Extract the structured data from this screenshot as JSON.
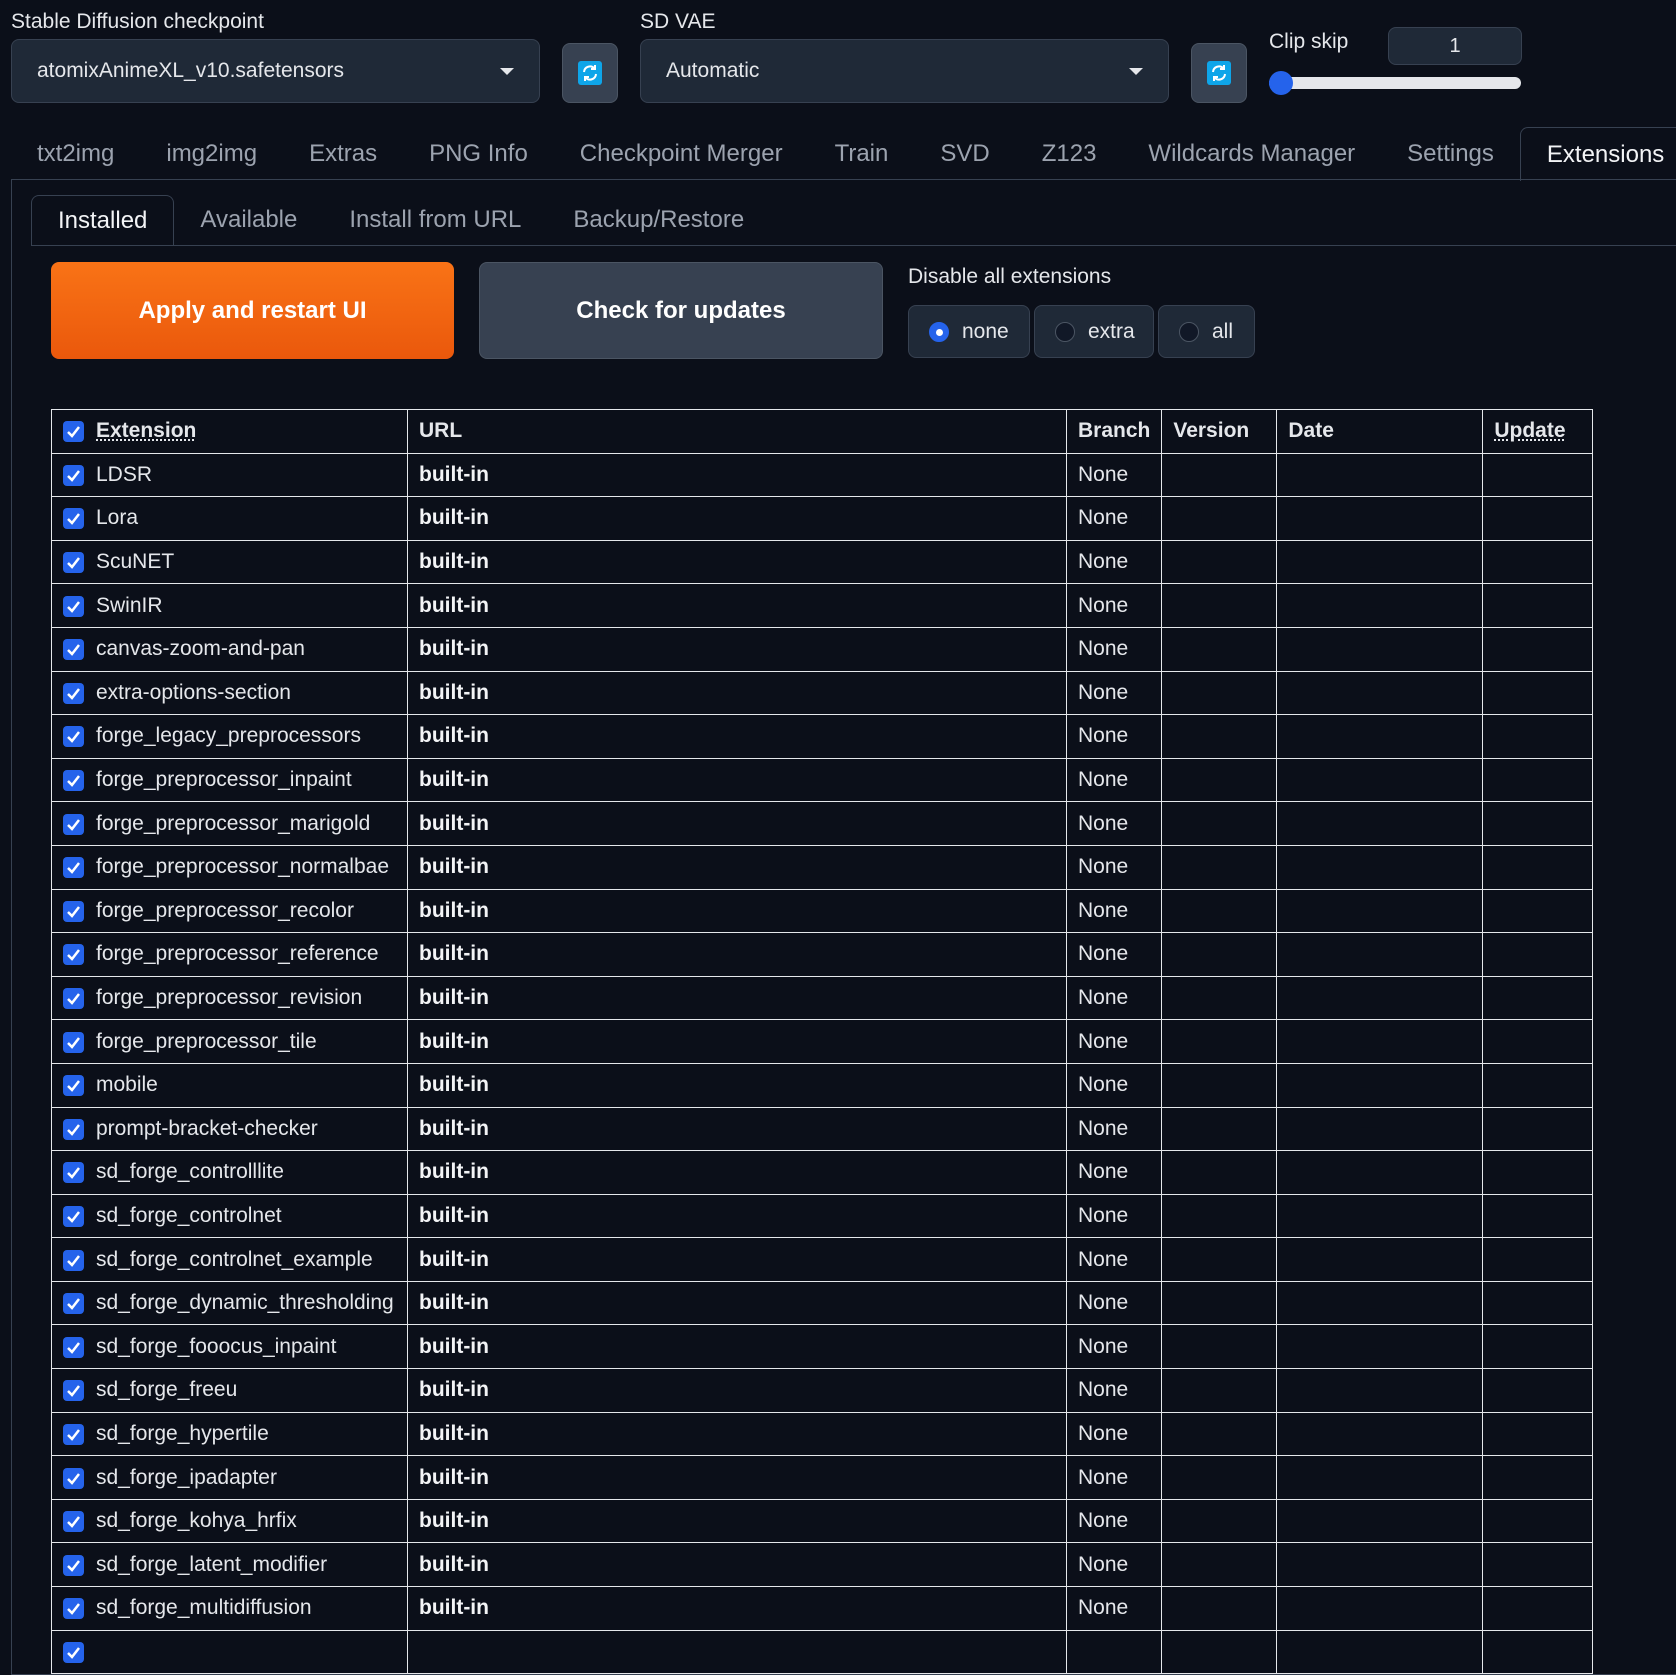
{
  "header": {
    "checkpoint_label": "Stable Diffusion checkpoint",
    "checkpoint_value": "atomixAnimeXL_v10.safetensors",
    "vae_label": "SD VAE",
    "vae_value": "Automatic",
    "clip_skip_label": "Clip skip",
    "clip_skip_value": "1",
    "clip_skip_fraction": 0.0
  },
  "main_tabs": [
    "txt2img",
    "img2img",
    "Extras",
    "PNG Info",
    "Checkpoint Merger",
    "Train",
    "SVD",
    "Z123",
    "Wildcards Manager",
    "Settings",
    "Extensions"
  ],
  "main_tab_active": "Extensions",
  "sub_tabs": [
    "Installed",
    "Available",
    "Install from URL",
    "Backup/Restore"
  ],
  "sub_tab_active": "Installed",
  "actions": {
    "apply_label": "Apply and restart UI",
    "check_label": "Check for updates",
    "disable_label": "Disable all extensions",
    "disable_options": [
      "none",
      "extra",
      "all"
    ],
    "disable_selected": "none"
  },
  "table": {
    "headers": [
      "Extension",
      "URL",
      "Branch",
      "Version",
      "Date",
      "Update"
    ],
    "rows": [
      {
        "name": "LDSR",
        "url": "built-in",
        "branch": "None"
      },
      {
        "name": "Lora",
        "url": "built-in",
        "branch": "None"
      },
      {
        "name": "ScuNET",
        "url": "built-in",
        "branch": "None"
      },
      {
        "name": "SwinIR",
        "url": "built-in",
        "branch": "None"
      },
      {
        "name": "canvas-zoom-and-pan",
        "url": "built-in",
        "branch": "None"
      },
      {
        "name": "extra-options-section",
        "url": "built-in",
        "branch": "None"
      },
      {
        "name": "forge_legacy_preprocessors",
        "url": "built-in",
        "branch": "None"
      },
      {
        "name": "forge_preprocessor_inpaint",
        "url": "built-in",
        "branch": "None"
      },
      {
        "name": "forge_preprocessor_marigold",
        "url": "built-in",
        "branch": "None"
      },
      {
        "name": "forge_preprocessor_normalbae",
        "url": "built-in",
        "branch": "None"
      },
      {
        "name": "forge_preprocessor_recolor",
        "url": "built-in",
        "branch": "None"
      },
      {
        "name": "forge_preprocessor_reference",
        "url": "built-in",
        "branch": "None"
      },
      {
        "name": "forge_preprocessor_revision",
        "url": "built-in",
        "branch": "None"
      },
      {
        "name": "forge_preprocessor_tile",
        "url": "built-in",
        "branch": "None"
      },
      {
        "name": "mobile",
        "url": "built-in",
        "branch": "None"
      },
      {
        "name": "prompt-bracket-checker",
        "url": "built-in",
        "branch": "None"
      },
      {
        "name": "sd_forge_controlllite",
        "url": "built-in",
        "branch": "None"
      },
      {
        "name": "sd_forge_controlnet",
        "url": "built-in",
        "branch": "None"
      },
      {
        "name": "sd_forge_controlnet_example",
        "url": "built-in",
        "branch": "None"
      },
      {
        "name": "sd_forge_dynamic_thresholding",
        "url": "built-in",
        "branch": "None"
      },
      {
        "name": "sd_forge_fooocus_inpaint",
        "url": "built-in",
        "branch": "None"
      },
      {
        "name": "sd_forge_freeu",
        "url": "built-in",
        "branch": "None"
      },
      {
        "name": "sd_forge_hypertile",
        "url": "built-in",
        "branch": "None"
      },
      {
        "name": "sd_forge_ipadapter",
        "url": "built-in",
        "branch": "None"
      },
      {
        "name": "sd_forge_kohya_hrfix",
        "url": "built-in",
        "branch": "None"
      },
      {
        "name": "sd_forge_latent_modifier",
        "url": "built-in",
        "branch": "None"
      },
      {
        "name": "sd_forge_multidiffusion",
        "url": "built-in",
        "branch": "None"
      },
      {
        "name": "",
        "url": "",
        "branch": ""
      }
    ]
  },
  "colors": {
    "accent": "#2563eb",
    "orange": "#f97316",
    "background": "#0b0f19"
  },
  "icons": {
    "refresh": "refresh-icon",
    "checkbox": "checkbox-checked-icon",
    "caret": "chevron-down-icon"
  }
}
